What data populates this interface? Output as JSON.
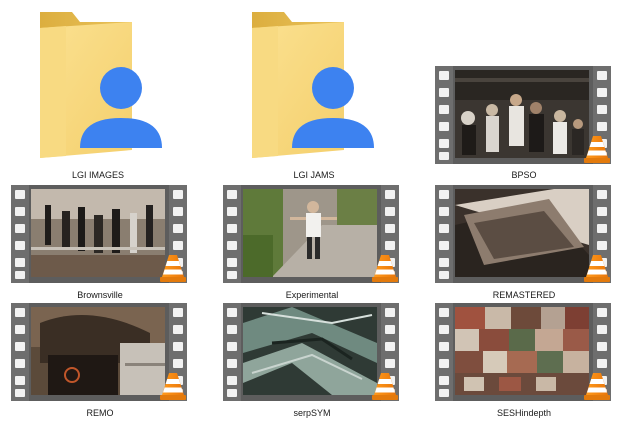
{
  "items": [
    {
      "name": "LGI IMAGES",
      "type": "folder",
      "icon": "user-folder-icon"
    },
    {
      "name": "LGI JAMS",
      "type": "folder",
      "icon": "user-folder-icon"
    },
    {
      "name": "BPSO",
      "type": "video",
      "icon": "vlc-cone-icon"
    },
    {
      "name": "Brownsville",
      "type": "video",
      "icon": "vlc-cone-icon"
    },
    {
      "name": "Experimental",
      "type": "video",
      "icon": "vlc-cone-icon"
    },
    {
      "name": "REMASTERED",
      "type": "video",
      "icon": "vlc-cone-icon"
    },
    {
      "name": "REMO",
      "type": "video",
      "icon": "vlc-cone-icon"
    },
    {
      "name": "serpSYM",
      "type": "video",
      "icon": "vlc-cone-icon"
    },
    {
      "name": "SESHindepth",
      "type": "video",
      "icon": "vlc-cone-icon"
    }
  ],
  "colors": {
    "folder_back": "#e3b74a",
    "folder_front": "#f6d57a",
    "user_badge": "#3d82f0",
    "film_strip": "#6a6a6a",
    "vlc_orange": "#f58a13"
  }
}
